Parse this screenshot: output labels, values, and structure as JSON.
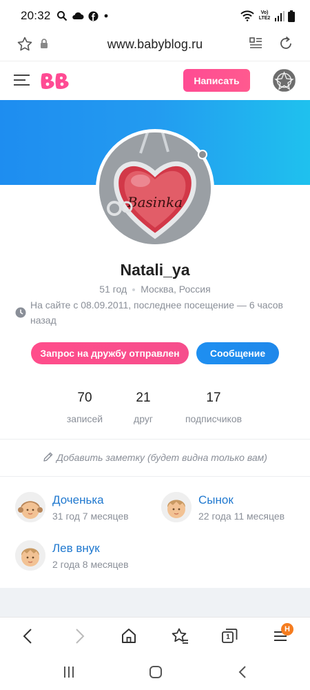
{
  "status_bar": {
    "time": "20:32",
    "left_icons": [
      "search-icon",
      "cloud-icon",
      "facebook-icon",
      "dot-icon"
    ],
    "right_icons": [
      "wifi-icon",
      "volte-icon",
      "signal-icon",
      "battery-icon"
    ],
    "network_label": "Vo) LTE2"
  },
  "browser": {
    "url": "www.babyblog.ru",
    "nav_icons": [
      "back-icon",
      "forward-icon",
      "home-icon",
      "bookmarks-icon",
      "tabs-icon",
      "menu-icon"
    ],
    "tabs_count": "1",
    "menu_badge": "H"
  },
  "header": {
    "logo_text": "BB",
    "write_button": "Написать"
  },
  "colors": {
    "accent_pink": "#ff4b93",
    "accent_blue": "#1e8ff1",
    "link_blue": "#1f78cf",
    "banner_start": "#1e8df0",
    "banner_end": "#1fc1ee"
  },
  "profile": {
    "username": "Natali_ya",
    "age": "51 год",
    "location": "Москва, Россия",
    "activity": "На сайте с 08.09.2011, последнее посещение — 6 часов назад",
    "avatar_text": "Basinka",
    "friend_button": "Запрос на дружбу отправлен",
    "message_button": "Сообщение"
  },
  "stats": [
    {
      "value": "70",
      "label": "записей"
    },
    {
      "value": "21",
      "label": "друг"
    },
    {
      "value": "17",
      "label": "подписчиков"
    }
  ],
  "note": {
    "text": "Добавить заметку (будет видна только вам)"
  },
  "children": [
    {
      "name": "Доченька",
      "age": "31 год 7 месяцев",
      "type": "girl"
    },
    {
      "name": "Сынок",
      "age": "22 года 11 месяцев",
      "type": "boy"
    },
    {
      "name": "Лев внук",
      "age": "2 года 8 месяцев",
      "type": "boy"
    }
  ]
}
